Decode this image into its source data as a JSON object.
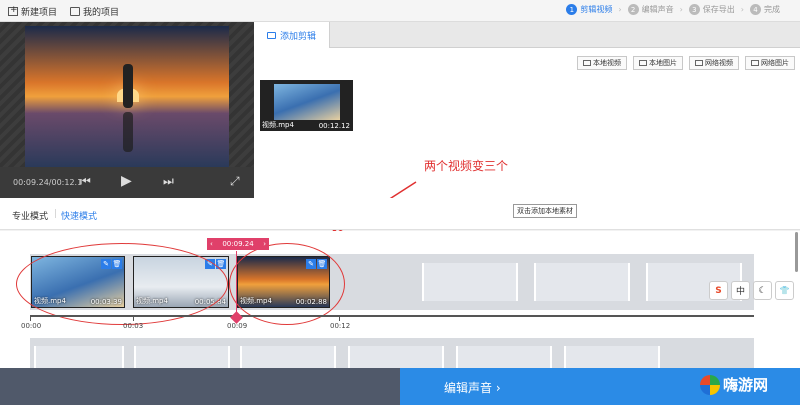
{
  "topbar": {
    "new_project": "新建项目",
    "my_projects": "我的项目",
    "steps": [
      {
        "num": "1",
        "label": "剪辑视频"
      },
      {
        "num": "2",
        "label": "编辑声音"
      },
      {
        "num": "3",
        "label": "保存导出"
      },
      {
        "num": "4",
        "label": "完成"
      }
    ]
  },
  "player": {
    "timecode": "00:09.24/00:12.1"
  },
  "right_panel": {
    "tab_label": "添加剪辑",
    "source_buttons": [
      "本地视频",
      "本地图片",
      "网络视频",
      "网络图片"
    ],
    "media_item": {
      "label": "视频.mp4",
      "duration": "00:12.12"
    },
    "annotation": "两个视频变三个"
  },
  "modes": {
    "pro": "专业模式",
    "quick": "快速模式",
    "tooltip": "双击添加本地素材"
  },
  "timeline": {
    "current_time": "00:09.24",
    "clips": [
      {
        "label": "视频.mp4",
        "duration": "00:03.39"
      },
      {
        "label": "视频.mp4",
        "duration": "00:05.84"
      },
      {
        "label": "视频.mp4",
        "duration": "00:02.88"
      }
    ],
    "ticks": [
      "00:00",
      "00:03",
      "00:09",
      "00:12"
    ]
  },
  "ime": [
    "S",
    "中",
    "☾",
    "👕"
  ],
  "footer": {
    "edit_audio": "编辑声音 ›",
    "brand": "嗨游网"
  },
  "colors": {
    "accent": "#2b7de9",
    "playhead": "#e0406a",
    "annotation": "#e03030",
    "footer_blue": "#2b8be6"
  }
}
